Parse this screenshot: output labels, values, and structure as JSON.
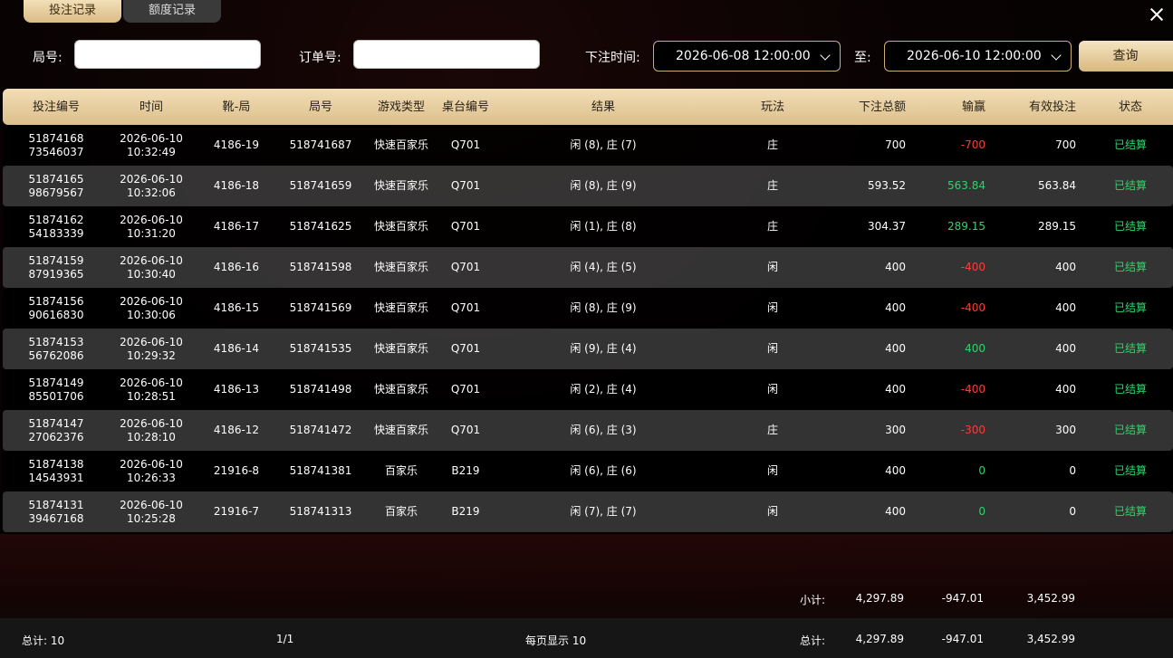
{
  "tabs": [
    {
      "label": "投注记录",
      "active": true
    },
    {
      "label": "额度记录",
      "active": false
    }
  ],
  "filters": {
    "round_label": "局号:",
    "round_value": "",
    "order_label": "订单号:",
    "order_value": "",
    "time_label": "下注时间:",
    "start_time": "2026-06-08 12:00:00",
    "to_label": "至:",
    "end_time": "2026-06-10 12:00:00",
    "query_label": "查询"
  },
  "columns": [
    "投注编号",
    "时间",
    "靴-局",
    "局号",
    "游戏类型",
    "桌台编号",
    "结果",
    "玩法",
    "下注总额",
    "输赢",
    "有效投注",
    "状态"
  ],
  "rows": [
    {
      "id1": "51874168",
      "id2": "73546037",
      "date": "2026-06-10",
      "time": "10:32:49",
      "shoe": "4186-19",
      "round": "518741687",
      "game": "快速百家乐",
      "table": "Q701",
      "result": "闲 (8), 庄 (7)",
      "play": "庄",
      "bet": "700",
      "winloss": "-700",
      "wl_sign": "neg",
      "valid": "700",
      "status": "已结算"
    },
    {
      "id1": "51874165",
      "id2": "98679567",
      "date": "2026-06-10",
      "time": "10:32:06",
      "shoe": "4186-18",
      "round": "518741659",
      "game": "快速百家乐",
      "table": "Q701",
      "result": "闲 (8), 庄 (9)",
      "play": "庄",
      "bet": "593.52",
      "winloss": "563.84",
      "wl_sign": "pos",
      "valid": "563.84",
      "status": "已结算"
    },
    {
      "id1": "51874162",
      "id2": "54183339",
      "date": "2026-06-10",
      "time": "10:31:20",
      "shoe": "4186-17",
      "round": "518741625",
      "game": "快速百家乐",
      "table": "Q701",
      "result": "闲 (1), 庄 (8)",
      "play": "庄",
      "bet": "304.37",
      "winloss": "289.15",
      "wl_sign": "pos",
      "valid": "289.15",
      "status": "已结算"
    },
    {
      "id1": "51874159",
      "id2": "87919365",
      "date": "2026-06-10",
      "time": "10:30:40",
      "shoe": "4186-16",
      "round": "518741598",
      "game": "快速百家乐",
      "table": "Q701",
      "result": "闲 (4), 庄 (5)",
      "play": "闲",
      "bet": "400",
      "winloss": "-400",
      "wl_sign": "neg",
      "valid": "400",
      "status": "已结算"
    },
    {
      "id1": "51874156",
      "id2": "90616830",
      "date": "2026-06-10",
      "time": "10:30:06",
      "shoe": "4186-15",
      "round": "518741569",
      "game": "快速百家乐",
      "table": "Q701",
      "result": "闲 (8), 庄 (9)",
      "play": "闲",
      "bet": "400",
      "winloss": "-400",
      "wl_sign": "neg",
      "valid": "400",
      "status": "已结算"
    },
    {
      "id1": "51874153",
      "id2": "56762086",
      "date": "2026-06-10",
      "time": "10:29:32",
      "shoe": "4186-14",
      "round": "518741535",
      "game": "快速百家乐",
      "table": "Q701",
      "result": "闲 (9), 庄 (4)",
      "play": "闲",
      "bet": "400",
      "winloss": "400",
      "wl_sign": "pos",
      "valid": "400",
      "status": "已结算"
    },
    {
      "id1": "51874149",
      "id2": "85501706",
      "date": "2026-06-10",
      "time": "10:28:51",
      "shoe": "4186-13",
      "round": "518741498",
      "game": "快速百家乐",
      "table": "Q701",
      "result": "闲 (2), 庄 (4)",
      "play": "闲",
      "bet": "400",
      "winloss": "-400",
      "wl_sign": "neg",
      "valid": "400",
      "status": "已结算"
    },
    {
      "id1": "51874147",
      "id2": "27062376",
      "date": "2026-06-10",
      "time": "10:28:10",
      "shoe": "4186-12",
      "round": "518741472",
      "game": "快速百家乐",
      "table": "Q701",
      "result": "闲 (6), 庄 (3)",
      "play": "庄",
      "bet": "300",
      "winloss": "-300",
      "wl_sign": "neg",
      "valid": "300",
      "status": "已结算"
    },
    {
      "id1": "51874138",
      "id2": "14543931",
      "date": "2026-06-10",
      "time": "10:26:33",
      "shoe": "21916-8",
      "round": "518741381",
      "game": "百家乐",
      "table": "B219",
      "result": "闲 (6), 庄 (6)",
      "play": "闲",
      "bet": "400",
      "winloss": "0",
      "wl_sign": "pos",
      "valid": "0",
      "status": "已结算"
    },
    {
      "id1": "51874131",
      "id2": "39467168",
      "date": "2026-06-10",
      "time": "10:25:28",
      "shoe": "21916-7",
      "round": "518741313",
      "game": "百家乐",
      "table": "B219",
      "result": "闲 (7), 庄 (7)",
      "play": "闲",
      "bet": "400",
      "winloss": "0",
      "wl_sign": "pos",
      "valid": "0",
      "status": "已结算"
    }
  ],
  "subtotal": {
    "label": "小计:",
    "bet": "4,297.89",
    "winloss": "-947.01",
    "valid": "3,452.99"
  },
  "footer": {
    "count_label": "总计: 10",
    "page": "1/1",
    "per_page": "每页显示 10",
    "total_label": "总计:",
    "bet": "4,297.89",
    "winloss": "-947.01",
    "valid": "3,452.99"
  },
  "colors": {
    "accent": "#d9bb86",
    "win": "#2fd36b",
    "loss": "#ff3b3b"
  }
}
